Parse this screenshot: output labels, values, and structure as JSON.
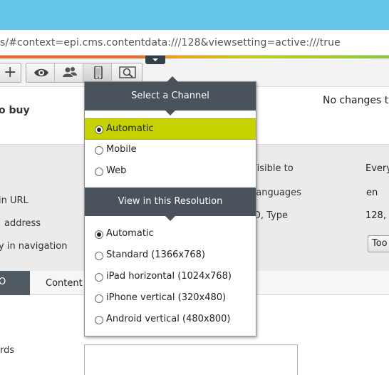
{
  "browser": {
    "url": "s/#context=epi.cms.contentdata:///128&viewsetting=active:///true"
  },
  "toolbar": {
    "add_label": "+"
  },
  "page": {
    "title": "o buy",
    "status": "No changes to"
  },
  "properties": {
    "left_labels": [
      "in URL",
      "address",
      "y in navigation"
    ],
    "right_labels": [
      "Visible to",
      "Languages",
      "ID, Type"
    ],
    "right_values": [
      "Every",
      "en",
      "128,"
    ],
    "tools_label": "Too"
  },
  "tabs": {
    "active": "O",
    "content": "Content"
  },
  "form": {
    "keywords_label": "rds"
  },
  "popup": {
    "channel_header": "Select a Channel",
    "channels": [
      {
        "label": "Automatic",
        "checked": true,
        "highlighted": true
      },
      {
        "label": "Mobile",
        "checked": false,
        "highlighted": false
      },
      {
        "label": "Web",
        "checked": false,
        "highlighted": false
      }
    ],
    "resolution_header": "View in this Resolution",
    "resolutions": [
      {
        "label": "Automatic",
        "checked": true
      },
      {
        "label": "Standard (1366x768)",
        "checked": false
      },
      {
        "label": "iPad horizontal (1024x768)",
        "checked": false
      },
      {
        "label": "iPhone vertical (320x480)",
        "checked": false
      },
      {
        "label": "Android vertical (480x800)",
        "checked": false
      }
    ]
  },
  "colors": {
    "titlebar": "#63c6e8",
    "popup_header": "#4a535b",
    "highlight": "#c6d300",
    "active_tab": "#505a63"
  },
  "icons": [
    "plus-icon",
    "eye-icon",
    "users-icon",
    "mobile-device-icon",
    "search-preview-icon",
    "caret-down-icon"
  ]
}
